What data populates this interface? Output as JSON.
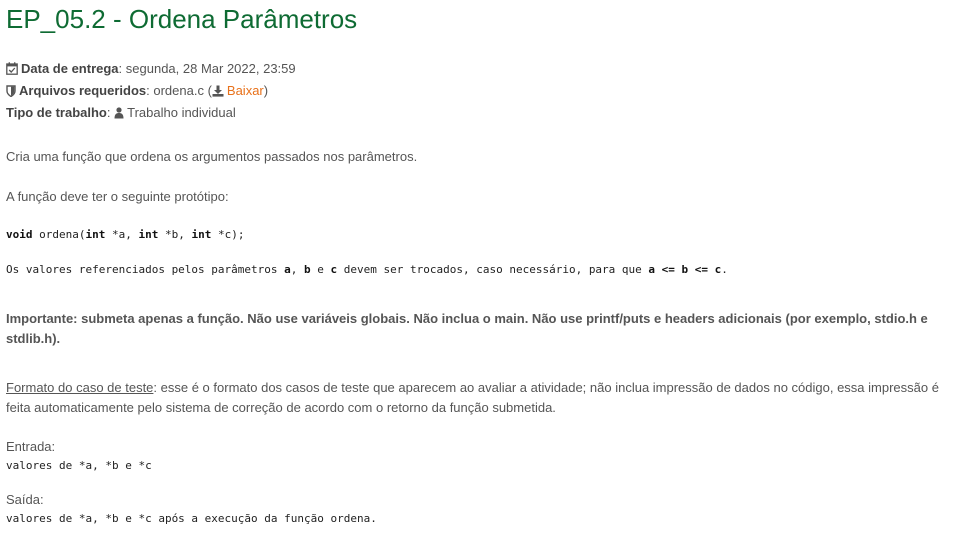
{
  "title": "EP_05.2 - Ordena Parâmetros",
  "meta": {
    "due_label": "Data de entrega",
    "due_value": ": segunda, 28 Mar 2022, 23:59",
    "files_label": "Arquivos requeridos",
    "files_value": ": ordena.c (",
    "download_label": "Baixar",
    "files_close": ")",
    "type_label": "Tipo de trabalho",
    "type_sep": ": ",
    "type_value": "Trabalho individual",
    "icons": [
      "calendar-check-icon",
      "shield-icon",
      "download-icon",
      "user-icon"
    ]
  },
  "content": {
    "intro": "Cria uma função que ordena os argumentos passados nos parâmetros.",
    "prototype_intro": "A função deve ter o seguinte protótipo:",
    "proto": {
      "kw_void": "void",
      "fn": " ordena(",
      "kw_int1": "int",
      "p1": " *a, ",
      "kw_int2": "int",
      "p2": " *b, ",
      "kw_int3": "int",
      "p3": " *c);"
    },
    "desc": {
      "t1": "Os valores referenciados pelos parâmetros ",
      "a": "a",
      "t2": ", ",
      "b": "b",
      "t3": " e ",
      "c": "c",
      "t4": " devem ser trocados, caso necessário, para que ",
      "cond": "a <= b <= c",
      "t5": "."
    },
    "important": "Importante: submeta apenas a função. Não use variáveis globais. Não inclua o main. Não use printf/puts e headers adicionais (por exemplo, stdio.h e stdlib.h).",
    "format_label": "Formato do caso de teste",
    "format_text": ": esse é o formato dos casos de teste que aparecem ao avaliar a atividade; não inclua impressão de dados no código, essa impressão é feita automaticamente pelo sistema de correção de acordo com o retorno da função submetida.",
    "input_label": "Entrada:",
    "input_value": "valores de *a, *b e *c",
    "output_label": "Saída:",
    "output_value": "valores de *a, *b e *c após a execução da função ordena."
  }
}
